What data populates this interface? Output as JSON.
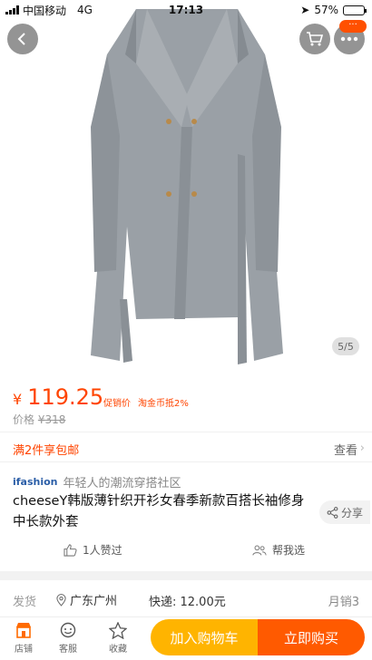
{
  "status_bar": {
    "carrier": "中国移动",
    "network": "4G",
    "time": "17:13",
    "battery": "57%",
    "battery_level": 0.57
  },
  "hero": {
    "pager": "5/5",
    "badge": "···"
  },
  "price": {
    "currency": "¥",
    "amount": "119.25",
    "tag_promo": "促销价",
    "tag_coin": "淘金币抵2%",
    "orig_label": "价格",
    "orig_value": "¥318"
  },
  "promo": {
    "label": "满2件享包邮",
    "action": "查看"
  },
  "brand": {
    "logo": "ifashion",
    "slogan": "年轻人的潮流穿搭社区"
  },
  "product": {
    "title": "cheeseY韩版薄针织开衫女春季新款百搭长袖修身中长款外套"
  },
  "share": {
    "label": "分享"
  },
  "social": {
    "likes": "1人赞过",
    "pick": "帮我选"
  },
  "shipping": {
    "label": "发货",
    "location": "广东广州",
    "fee": "快递: 12.00元",
    "sales": "月销3"
  },
  "bottom_bar": {
    "shop": "店铺",
    "service": "客服",
    "favorite": "收藏",
    "add_cart": "加入购物车",
    "buy_now": "立即购买"
  },
  "colors": {
    "accent": "#ff4400",
    "cart_button": "#ffb400",
    "buy_button": "#ff5a00"
  }
}
